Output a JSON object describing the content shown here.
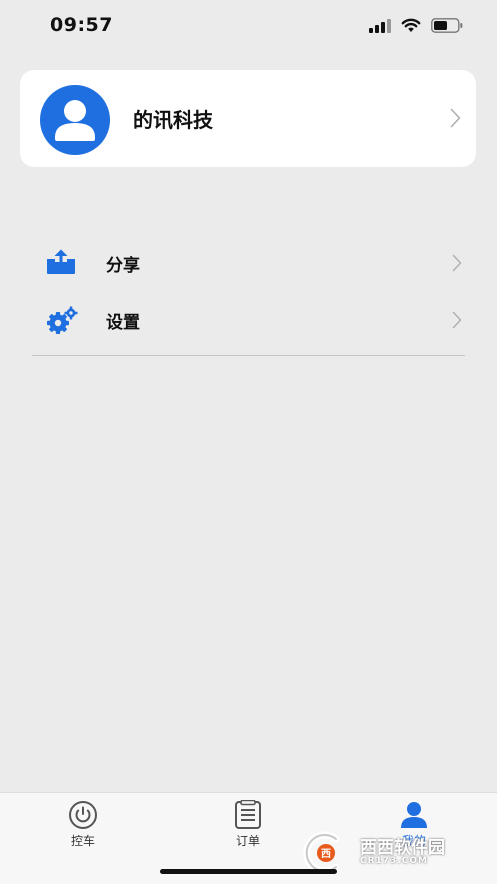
{
  "status_bar": {
    "time": "09:57",
    "signal_icon": "cellular-signal-icon",
    "wifi_icon": "wifi-icon",
    "battery_icon": "battery-icon"
  },
  "profile": {
    "avatar_icon": "user-avatar-icon",
    "name": "的讯科技",
    "chevron_icon": "chevron-right-icon"
  },
  "menu": {
    "items": [
      {
        "label": "分享",
        "icon": "share-upload-icon"
      },
      {
        "label": "设置",
        "icon": "gears-settings-icon"
      }
    ]
  },
  "tab_bar": {
    "tabs": [
      {
        "label": "控车",
        "icon": "power-icon",
        "active": false
      },
      {
        "label": "订单",
        "icon": "order-list-icon",
        "active": false
      },
      {
        "label": "我的",
        "icon": "person-icon",
        "active": true
      }
    ]
  },
  "watermark": {
    "logo_text": "西西软件园",
    "sub_text": "CR173.COM"
  },
  "colors": {
    "accent": "#1f6fe0",
    "page_background": "#ebebeb",
    "card_background": "#ffffff"
  }
}
